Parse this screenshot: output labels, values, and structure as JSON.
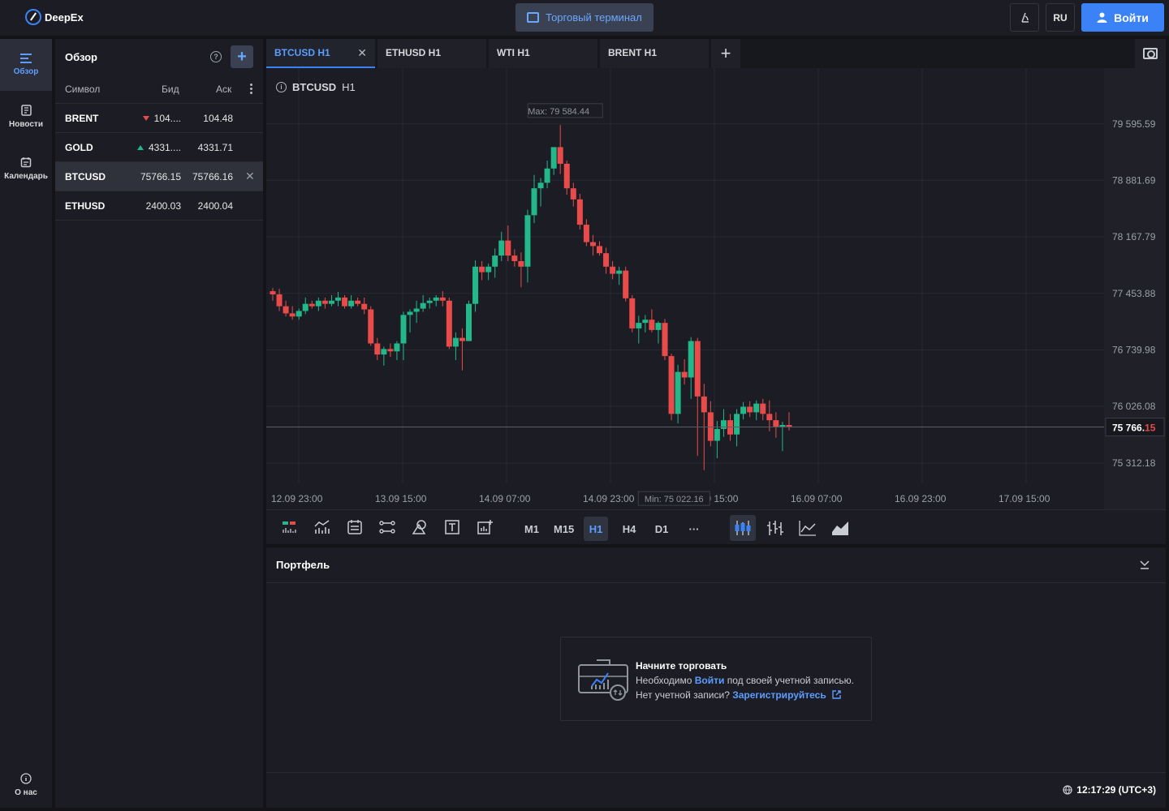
{
  "app": {
    "name": "DeepEx"
  },
  "header": {
    "terminal_label": "Торговый терминал",
    "lang": "RU",
    "login_label": "Войти"
  },
  "nav": {
    "items": [
      {
        "label": "Обзор",
        "icon": "list-add-icon",
        "active": true
      },
      {
        "label": "Новости",
        "icon": "news-icon"
      },
      {
        "label": "Календарь",
        "icon": "calendar-icon"
      }
    ],
    "about": "О нас"
  },
  "watchlist": {
    "title": "Обзор",
    "columns": {
      "symbol": "Символ",
      "bid": "Бид",
      "ask": "Аск"
    },
    "rows": [
      {
        "symbol": "BRENT",
        "bid": "104....",
        "ask": "104.48",
        "dir": "down"
      },
      {
        "symbol": "GOLD",
        "bid": "4331....",
        "ask": "4331.71",
        "dir": "up"
      },
      {
        "symbol": "BTCUSD",
        "bid": "75766.15",
        "ask": "75766.16",
        "dir": "none",
        "selected": true
      },
      {
        "symbol": "ETHUSD",
        "bid": "2400.03",
        "ask": "2400.04",
        "dir": "none"
      }
    ]
  },
  "tabs": [
    {
      "label": "BTCUSD H1",
      "active": true
    },
    {
      "label": "ETHUSD H1"
    },
    {
      "label": "WTI H1"
    },
    {
      "label": "BRENT H1"
    }
  ],
  "chart": {
    "symbol": "BTCUSD",
    "timeframe": "H1",
    "max_label": "Max: 79 584.44",
    "min_label": "Min: 75 022.16",
    "current_price_main": "75 766.",
    "current_price_tail": "15",
    "timeframes": [
      "M1",
      "M15",
      "H1",
      "H4",
      "D1",
      "···"
    ],
    "active_timeframe": "H1"
  },
  "chart_data": {
    "type": "candlestick",
    "y_ticks": [
      79595.59,
      78881.69,
      78167.79,
      77453.88,
      76739.98,
      76026.08,
      75312.18
    ],
    "y_tick_labels": [
      "79 595.59",
      "78 881.69",
      "78 167.79",
      "77 453.88",
      "76 739.98",
      "76 026.08",
      "75 312.18"
    ],
    "x_tick_labels": [
      "12.09 23:00",
      "13.09 15:00",
      "14.09 07:00",
      "14.09 23:00",
      "15.09 15:00",
      "16.09 07:00",
      "16.09 23:00",
      "17.09 15:00"
    ],
    "ylim": [
      74870,
      80300
    ],
    "current_price": 75766.15,
    "max": 79584.44,
    "min": 75022.16,
    "colors": {
      "up": "#22b88a",
      "down": "#e94b4b"
    },
    "candles": [
      [
        77482,
        77522,
        77362,
        77442
      ],
      [
        77442,
        77512,
        77232,
        77292
      ],
      [
        77292,
        77362,
        77162,
        77202
      ],
      [
        77202,
        77292,
        77122,
        77162
      ],
      [
        77162,
        77262,
        77122,
        77232
      ],
      [
        77232,
        77402,
        77192,
        77322
      ],
      [
        77322,
        77362,
        77262,
        77292
      ],
      [
        77292,
        77402,
        77232,
        77362
      ],
      [
        77362,
        77402,
        77262,
        77322
      ],
      [
        77322,
        77432,
        77292,
        77362
      ],
      [
        77362,
        77472,
        77292,
        77402
      ],
      [
        77402,
        77432,
        77262,
        77292
      ],
      [
        77292,
        77432,
        77262,
        77362
      ],
      [
        77362,
        77402,
        77292,
        77322
      ],
      [
        77322,
        77402,
        77192,
        77252
      ],
      [
        77252,
        77292,
        76792,
        76822
      ],
      [
        76822,
        76892,
        76612,
        76682
      ],
      [
        76682,
        76782,
        76542,
        76752
      ],
      [
        76752,
        76822,
        76652,
        76722
      ],
      [
        76722,
        76852,
        76612,
        76822
      ],
      [
        76822,
        77222,
        76612,
        77182
      ],
      [
        77182,
        77252,
        76962,
        77222
      ],
      [
        77222,
        77362,
        77082,
        77262
      ],
      [
        77262,
        77432,
        77222,
        77332
      ],
      [
        77332,
        77402,
        77262,
        77362
      ],
      [
        77362,
        77432,
        77292,
        77402
      ],
      [
        77402,
        77482,
        77292,
        77362
      ],
      [
        77362,
        77402,
        76752,
        76782
      ],
      [
        76782,
        76962,
        76612,
        76892
      ],
      [
        76892,
        77012,
        76482,
        76852
      ],
      [
        76852,
        77362,
        76852,
        77322
      ],
      [
        77322,
        77872,
        77222,
        77792
      ],
      [
        77792,
        77862,
        77622,
        77722
      ],
      [
        77722,
        77832,
        77622,
        77792
      ],
      [
        77792,
        78022,
        77652,
        77932
      ],
      [
        77932,
        78232,
        77862,
        78122
      ],
      [
        78122,
        78312,
        77862,
        77932
      ],
      [
        77932,
        78012,
        77792,
        77862
      ],
      [
        77862,
        77972,
        77532,
        77792
      ],
      [
        77792,
        78512,
        77592,
        78442
      ],
      [
        78442,
        78952,
        78342,
        78782
      ],
      [
        78782,
        78912,
        78552,
        78852
      ],
      [
        78852,
        79132,
        78782,
        79032
      ],
      [
        79032,
        79302,
        78952,
        79302
      ],
      [
        79302,
        79582,
        78962,
        79092
      ],
      [
        79092,
        79132,
        78702,
        78782
      ],
      [
        78782,
        78852,
        78552,
        78642
      ],
      [
        78642,
        78712,
        78262,
        78322
      ],
      [
        78322,
        78392,
        78052,
        78102
      ],
      [
        78102,
        78192,
        77932,
        78052
      ],
      [
        78052,
        78112,
        77932,
        77962
      ],
      [
        77962,
        78032,
        77702,
        77792
      ],
      [
        77792,
        77862,
        77632,
        77702
      ],
      [
        77702,
        77792,
        77562,
        77742
      ],
      [
        77742,
        77792,
        77352,
        77392
      ],
      [
        77392,
        77432,
        76962,
        77012
      ],
      [
        77012,
        77172,
        76822,
        77082
      ],
      [
        77082,
        77182,
        76962,
        77122
      ],
      [
        77122,
        77252,
        76962,
        76992
      ],
      [
        76992,
        77102,
        76822,
        77082
      ],
      [
        77082,
        77132,
        76612,
        76662
      ],
      [
        76662,
        76692,
        75852,
        75932
      ],
      [
        75932,
        76552,
        75812,
        76462
      ],
      [
        76462,
        76622,
        76302,
        76392
      ],
      [
        76392,
        76902,
        76122,
        76852
      ],
      [
        76852,
        76892,
        75402,
        76152
      ],
      [
        76152,
        76312,
        75222,
        75952
      ],
      [
        75952,
        76092,
        75522,
        75592
      ],
      [
        75592,
        75842,
        75372,
        75742
      ],
      [
        75742,
        75992,
        75642,
        75852
      ],
      [
        75852,
        75932,
        75592,
        75672
      ],
      [
        75672,
        75992,
        75522,
        75932
      ],
      [
        75932,
        76082,
        75862,
        76022
      ],
      [
        76022,
        76092,
        75892,
        75952
      ],
      [
        75952,
        76102,
        75852,
        76062
      ],
      [
        76062,
        76122,
        75852,
        75932
      ],
      [
        75932,
        76102,
        75712,
        75852
      ],
      [
        75852,
        75952,
        75632,
        75772
      ],
      [
        75772,
        75832,
        75462,
        75792
      ],
      [
        75792,
        75952,
        75722,
        75772
      ]
    ]
  },
  "portfolio": {
    "title": "Портфель",
    "empty_title": "Начните торговать",
    "line1_prefix": "Необходимо ",
    "line1_link": "Войти",
    "line1_suffix": " под своей учетной записью.",
    "line2_prefix": "Нет учетной записи? ",
    "line2_link": "Зарегистрируйтесь"
  },
  "footer": {
    "time": "12:17:29 (UTC+3)"
  }
}
